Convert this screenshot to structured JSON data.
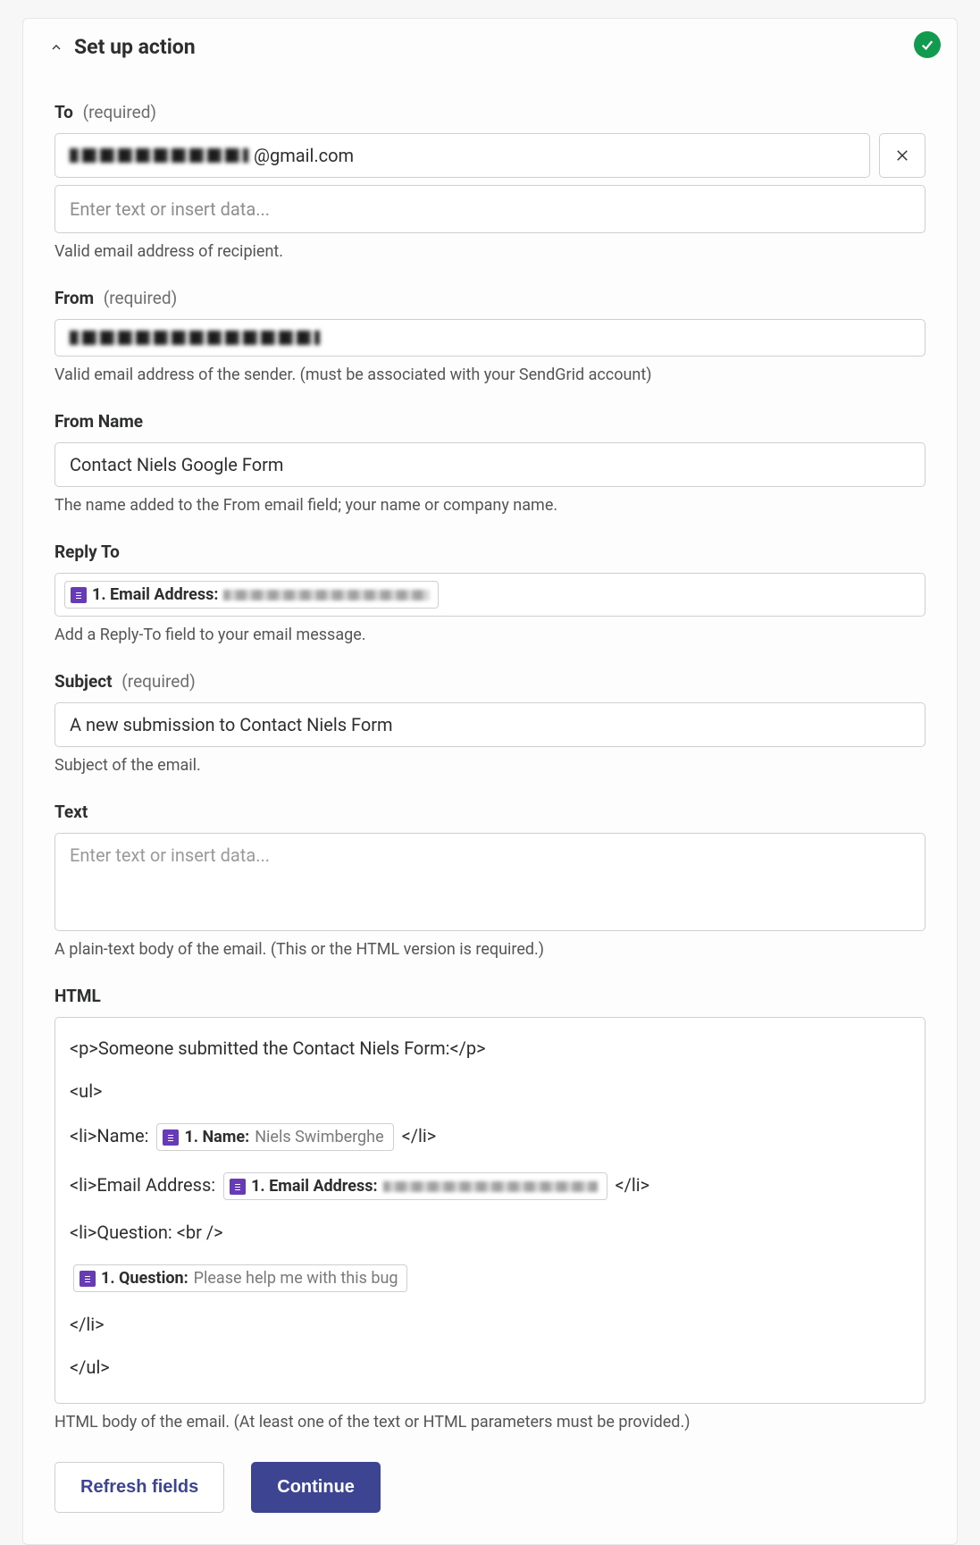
{
  "header": {
    "title": "Set up action"
  },
  "fields": {
    "to": {
      "label": "To",
      "required": "(required)",
      "value_suffix": "@gmail.com",
      "placeholder": "Enter text or insert data...",
      "help": "Valid email address of recipient."
    },
    "from": {
      "label": "From",
      "required": "(required)",
      "help": "Valid email address of the sender. (must be associated with your SendGrid account)"
    },
    "from_name": {
      "label": "From Name",
      "value": "Contact Niels Google Form",
      "help": "The name added to the From email field; your name or company name."
    },
    "reply_to": {
      "label": "Reply To",
      "pill_label": "1. Email Address:",
      "help": "Add a Reply-To field to your email message."
    },
    "subject": {
      "label": "Subject",
      "required": "(required)",
      "value": "A new submission to Contact Niels Form",
      "help": "Subject of the email."
    },
    "text": {
      "label": "Text",
      "placeholder": "Enter text or insert data...",
      "help": "A plain-text body of the email. (This or the HTML version is required.)"
    },
    "html": {
      "label": "HTML",
      "line1": "<p>Someone submitted the Contact Niels Form:</p>",
      "line2": "<ul>",
      "line3_pre": "<li>Name: ",
      "line3_pill_label": "1. Name:",
      "line3_pill_value": "Niels Swimberghe",
      "line3_post": "</li>",
      "line4_pre": "<li>Email Address: ",
      "line4_pill_label": "1. Email Address:",
      "line4_post": "</li>",
      "line5": "<li>Question: <br />",
      "line6_pill_label": "1. Question:",
      "line6_pill_value": "Please help me with this bug",
      "line7": "</li>",
      "line8": "</ul>",
      "help": "HTML body of the email. (At least one of the text or HTML parameters must be provided.)"
    }
  },
  "actions": {
    "refresh": "Refresh fields",
    "continue": "Continue"
  }
}
